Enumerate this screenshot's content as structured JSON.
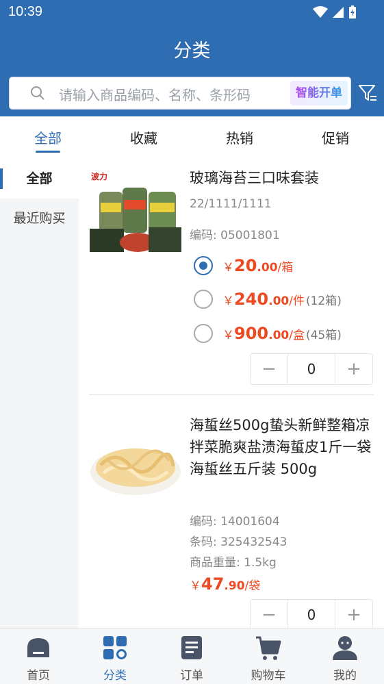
{
  "status": {
    "time": "10:39"
  },
  "header": {
    "title": "分类"
  },
  "search": {
    "placeholder": "请输入商品编码、名称、条形码",
    "smart_order_label": "智能开单"
  },
  "tabs": [
    {
      "label": "全部",
      "active": true
    },
    {
      "label": "收藏",
      "active": false
    },
    {
      "label": "热销",
      "active": false
    },
    {
      "label": "促销",
      "active": false
    }
  ],
  "sidebar": {
    "items": [
      {
        "label": "全部",
        "active": true
      },
      {
        "label": "最近购买",
        "active": false
      }
    ]
  },
  "products": [
    {
      "name": "玻璃海苔三口味套装",
      "spec": "22/1111/1111",
      "code": "编码: 05001801",
      "prices": [
        {
          "currency": "￥",
          "int": "20",
          "dec": ".00",
          "unit": "/箱",
          "extra": "",
          "selected": true
        },
        {
          "currency": "￥",
          "int": "240",
          "dec": ".00",
          "unit": "/件",
          "extra": "(12箱)",
          "selected": false
        },
        {
          "currency": "￥",
          "int": "900",
          "dec": ".00",
          "unit": "/盒",
          "extra": "(45箱)",
          "selected": false
        }
      ],
      "quantity": "0",
      "image_brand": "波力"
    },
    {
      "name": "海蜇丝500g蛰头新鲜整箱凉拌菜脆爽盐渍海蜇皮1斤一袋海蜇丝五斤装 500g",
      "code": "编码: 14001604",
      "barcode": "条码: 325432543",
      "weight": "商品重量: 1.5kg",
      "price": {
        "currency": "￥",
        "int": "47",
        "dec": ".90",
        "unit": "/袋"
      },
      "quantity": "0"
    }
  ],
  "stepper": {
    "minus": "−",
    "plus": "+"
  },
  "bottom_nav": [
    {
      "label": "首页",
      "icon": "home-icon",
      "active": false
    },
    {
      "label": "分类",
      "icon": "category-icon",
      "active": true
    },
    {
      "label": "订单",
      "icon": "order-icon",
      "active": false
    },
    {
      "label": "购物车",
      "icon": "cart-icon",
      "active": false
    },
    {
      "label": "我的",
      "icon": "profile-icon",
      "active": false
    }
  ],
  "colors": {
    "primary": "#2f6db3",
    "price": "#ee4a22",
    "sidebar_bg": "#f4f5f7"
  }
}
